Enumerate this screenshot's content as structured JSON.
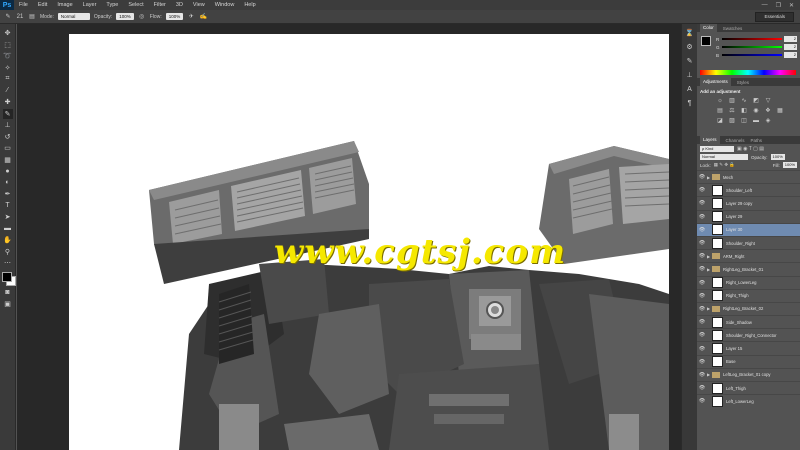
{
  "app": {
    "logo": "Ps"
  },
  "menu": [
    "File",
    "Edit",
    "Image",
    "Layer",
    "Type",
    "Select",
    "Filter",
    "3D",
    "View",
    "Window",
    "Help"
  ],
  "window_controls": [
    "—",
    "❐",
    "✕"
  ],
  "options": {
    "mode_label": "Mode:",
    "mode_value": "Normal",
    "opacity_label": "Opacity:",
    "opacity_value": "100%",
    "flow_label": "Flow:",
    "flow_value": "100%",
    "brush_size": "21",
    "workspace": "Essentials"
  },
  "tools": [
    "move-icon",
    "marquee-icon",
    "lasso-icon",
    "quick-select-icon",
    "crop-icon",
    "eyedropper-icon",
    "healing-icon",
    "brush-icon",
    "stamp-icon",
    "history-brush-icon",
    "eraser-icon",
    "gradient-icon",
    "blur-icon",
    "dodge-icon",
    "pen-icon",
    "type-icon",
    "path-select-icon",
    "shape-icon",
    "hand-icon",
    "zoom-icon"
  ],
  "watermark": "www.cgtsj.com",
  "color_panel": {
    "tabs": [
      "Color",
      "Swatches"
    ],
    "sliders": [
      {
        "label": "R",
        "value": "2",
        "color": "#d02020"
      },
      {
        "label": "G",
        "value": "2",
        "color": "#20b020"
      },
      {
        "label": "B",
        "value": "2",
        "color": "#3050e0"
      }
    ]
  },
  "adjustments_panel": {
    "tabs": [
      "Adjustments",
      "Styles"
    ],
    "title": "Add an adjustment"
  },
  "layers_panel": {
    "tabs": [
      "Layers",
      "Channels",
      "Paths"
    ],
    "filter": "ρ Kind",
    "blend_mode": "Normal",
    "opacity_label": "Opacity:",
    "opacity_value": "100%",
    "lock_label": "Lock:",
    "fill_label": "Fill:",
    "fill_value": "100%",
    "layers": [
      {
        "name": "Mech",
        "type": "group",
        "selected": false
      },
      {
        "name": "Shoulder_Left",
        "type": "layer",
        "selected": false
      },
      {
        "name": "Layer 29 copy",
        "type": "layer",
        "selected": false
      },
      {
        "name": "Layer 29",
        "type": "layer",
        "selected": false
      },
      {
        "name": "Layer 30",
        "type": "layer",
        "selected": true
      },
      {
        "name": "Shoulder_Right",
        "type": "layer",
        "selected": false
      },
      {
        "name": "ARM_Right",
        "type": "group",
        "selected": false
      },
      {
        "name": "RightLeg_Bracket_01",
        "type": "group",
        "selected": false
      },
      {
        "name": "Right_LowerLeg",
        "type": "layer",
        "selected": false
      },
      {
        "name": "Right_Thigh",
        "type": "layer",
        "selected": false
      },
      {
        "name": "RightLeg_Bracket_02",
        "type": "group",
        "selected": false
      },
      {
        "name": "Side_Shadow",
        "type": "layer",
        "selected": false
      },
      {
        "name": "Shoulder_Right_Connector",
        "type": "layer",
        "selected": false
      },
      {
        "name": "Layer 15",
        "type": "layer",
        "selected": false
      },
      {
        "name": "Base",
        "type": "layer",
        "selected": false
      },
      {
        "name": "LeftLeg_Bracket_01 copy",
        "type": "group",
        "selected": false
      },
      {
        "name": "Left_Thigh",
        "type": "layer",
        "selected": false
      },
      {
        "name": "Left_LowerLeg",
        "type": "layer",
        "selected": false
      }
    ]
  }
}
